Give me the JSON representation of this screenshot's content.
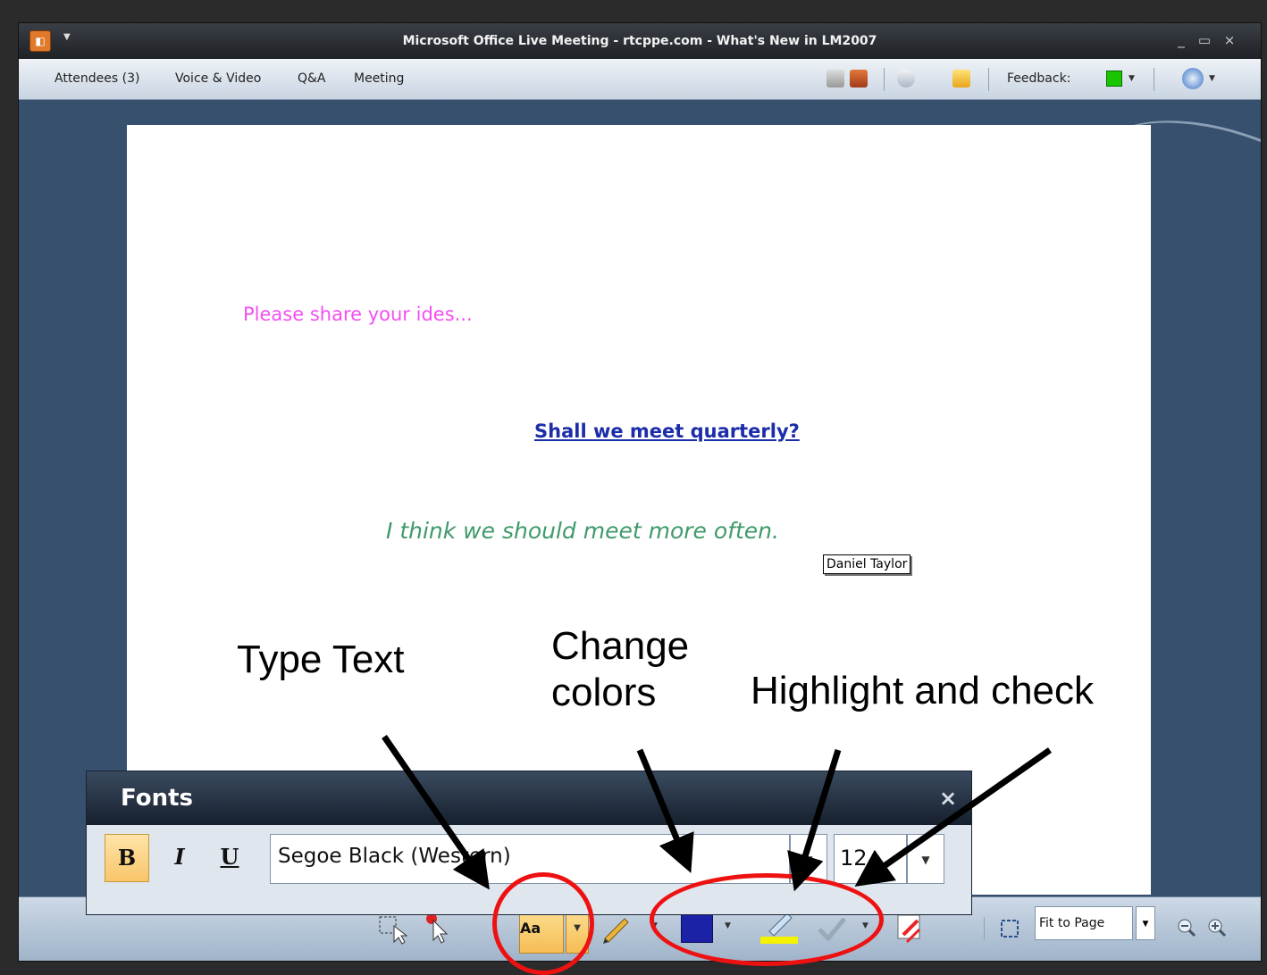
{
  "window": {
    "title": "Microsoft Office Live Meeting - rtcppe.com - What's New in LM2007",
    "minimize": "_",
    "maximize": "▭",
    "close": "×"
  },
  "menubar": {
    "items": [
      "Attendees (3)",
      "Voice & Video",
      "Q&A",
      "Meeting"
    ],
    "feedback_label": "Feedback:",
    "feedback_color": "#19c400"
  },
  "slide": {
    "line1": "Please share your ides...",
    "line2": "Shall we meet quarterly?",
    "line3": "I think we should meet more often.",
    "author_tag": "Daniel Taylor"
  },
  "annotations": {
    "type_text": "Type Text",
    "change_colors_1": "Change",
    "change_colors_2": "colors",
    "highlight_check": "Highlight and check"
  },
  "fonts_panel": {
    "title": "Fonts",
    "close": "×",
    "bold": "B",
    "italic": "I",
    "underline": "U",
    "font_name": "Segoe Black (Western)",
    "font_size": "12"
  },
  "bottom_toolbar": {
    "text_tool_label": "Aa",
    "pen_color": "#1c22a6",
    "highlighter_color": "#f5f200",
    "zoom_mode": "Fit to Page"
  },
  "colors": {
    "annotation_ring": "#ee1111"
  }
}
